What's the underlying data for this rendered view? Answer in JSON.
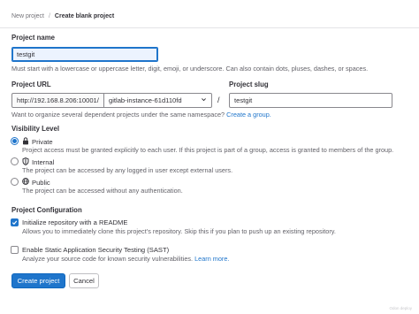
{
  "breadcrumb": {
    "parent": "New project",
    "separator": "/",
    "current": "Create blank project"
  },
  "project_name": {
    "label": "Project name",
    "value": "testgit",
    "help": "Must start with a lowercase or uppercase letter, digit, emoji, or underscore. Can also contain dots, pluses, dashes, or spaces."
  },
  "project_url": {
    "label": "Project URL",
    "prefix": "http://192.168.8.206:10001/",
    "namespace": "gitlab-instance-61d110fd",
    "separator": "/",
    "help_text": "Want to organize several dependent projects under the same namespace?",
    "help_link": "Create a group."
  },
  "project_slug": {
    "label": "Project slug",
    "value": "testgit"
  },
  "visibility": {
    "label": "Visibility Level",
    "selected": "private",
    "options": [
      {
        "key": "private",
        "title": "Private",
        "description": "Project access must be granted explicitly to each user. If this project is part of a group, access is granted to members of the group."
      },
      {
        "key": "internal",
        "title": "Internal",
        "description": "The project can be accessed by any logged in user except external users."
      },
      {
        "key": "public",
        "title": "Public",
        "description": "The project can be accessed without any authentication."
      }
    ]
  },
  "configuration": {
    "label": "Project Configuration",
    "readme": {
      "checked": true,
      "title": "Initialize repository with a README",
      "description": "Allows you to immediately clone this project’s repository. Skip this if you plan to push up an existing repository."
    },
    "sast": {
      "checked": false,
      "title": "Enable Static Application Security Testing (SAST)",
      "description": "Analyze your source code for known security vulnerabilities.",
      "link": "Learn more."
    }
  },
  "actions": {
    "create": "Create project",
    "cancel": "Cancel"
  },
  "watermark": "Odon deploy",
  "colors": {
    "accent": "#1f75cb",
    "text": "#333238",
    "muted": "#626168"
  }
}
